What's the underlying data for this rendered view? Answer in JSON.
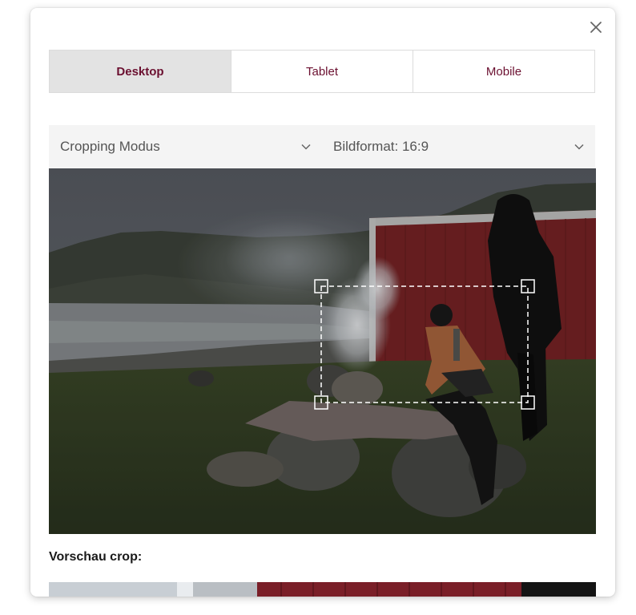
{
  "dialog": {
    "close_icon": "close-icon"
  },
  "tabs": [
    {
      "label": "Desktop",
      "active": true
    },
    {
      "label": "Tablet",
      "active": false
    },
    {
      "label": "Mobile",
      "active": false
    }
  ],
  "controls": {
    "cropping_mode": {
      "value": "Cropping Modus",
      "icon": "chevron-down-icon"
    },
    "aspect_ratio": {
      "value": "Bildformat: 16:9",
      "icon": "chevron-down-icon"
    }
  },
  "preview": {
    "label": "Vorschau crop:"
  },
  "colors": {
    "accent": "#6b1030",
    "active_tab_bg": "#e3e3e3",
    "select_bg": "#f4f4f4"
  }
}
